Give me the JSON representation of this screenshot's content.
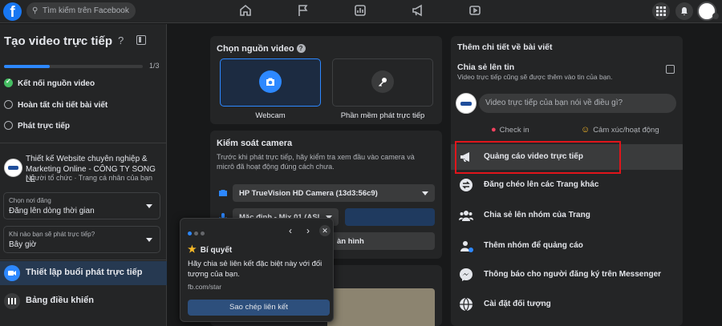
{
  "topbar": {
    "logo": "f",
    "search_placeholder": "Tìm kiếm trên Facebook"
  },
  "sidebar": {
    "title": "Tạo video trực tiếp",
    "help": "?",
    "progress_text": "1/3",
    "progress_fraction": 0.33,
    "steps": [
      {
        "label": "Kết nối nguồn video",
        "done": true
      },
      {
        "label": "Hoàn tất chi tiết bài viết",
        "done": false
      },
      {
        "label": "Phát trực tiếp",
        "done": false
      }
    ],
    "page_name": "Thiết kế Website chuyên nghiệp & Marketing Online - CÔNG TY SONG LÊ",
    "page_sub": "Người tổ chức · Trang cá nhân của bạn",
    "post_where_label": "Chọn nơi đăng",
    "post_where_value": "Đăng lên dòng thời gian",
    "when_label": "Khi nào bạn sẽ phát trực tiếp?",
    "when_value": "Bây giờ",
    "nav": [
      {
        "label": "Thiết lập buổi phát trực tiếp",
        "active": true
      },
      {
        "label": "Bảng điều khiển",
        "active": false
      }
    ]
  },
  "source_card": {
    "title": "Chọn nguồn video",
    "help": "?",
    "options": [
      "Webcam",
      "Phần mềm phát trực tiếp"
    ],
    "selected": "Webcam"
  },
  "camera_card": {
    "title": "Kiểm soát camera",
    "description": "Trước khi phát trực tiếp, hãy kiểm tra xem đầu vào camera và micrô đã hoạt động đúng cách chưa.",
    "camera_value": "HP TrueVision HD Camera (13d3:56c9)",
    "mic_value": "Mặc định - Mix 01 (ASI...",
    "screen_button_partial": "àn hình"
  },
  "popup": {
    "prev": "‹",
    "next": "›",
    "close": "✕",
    "title": "Bí quyết",
    "body": "Hãy chia sẻ liên kết đặc biệt này với đối tượng của bạn.",
    "link": "fb.com/star",
    "button": "Sao chép liên kết"
  },
  "details": {
    "title": "Thêm chi tiết về bài viết",
    "share_title": "Chia sẻ lên tin",
    "share_sub": "Video trực tiếp cũng sẽ được thêm vào tin của bạn.",
    "input_placeholder": "Video trực tiếp của bạn nói về điều gì?",
    "checkin": "Check in",
    "feeling": "Cảm xúc/hoạt động",
    "options": [
      {
        "label": "Quảng cáo video trực tiếp",
        "icon": "megaphone-icon"
      },
      {
        "label": "Đăng chéo lên các Trang khác",
        "icon": "crosspost-icon"
      },
      {
        "label": "Chia sẻ lên nhóm của Trang",
        "icon": "group-icon"
      },
      {
        "label": "Thêm nhóm để quảng cáo",
        "icon": "group-add-icon"
      },
      {
        "label": "Thông báo cho người đăng ký trên Messenger",
        "icon": "messenger-icon"
      },
      {
        "label": "Cài đặt đối tượng",
        "icon": "globe-icon"
      }
    ]
  },
  "colors": {
    "accent": "#2d88ff",
    "highlight_box": "#e0151b",
    "background": "#18191a",
    "card": "#242526"
  }
}
